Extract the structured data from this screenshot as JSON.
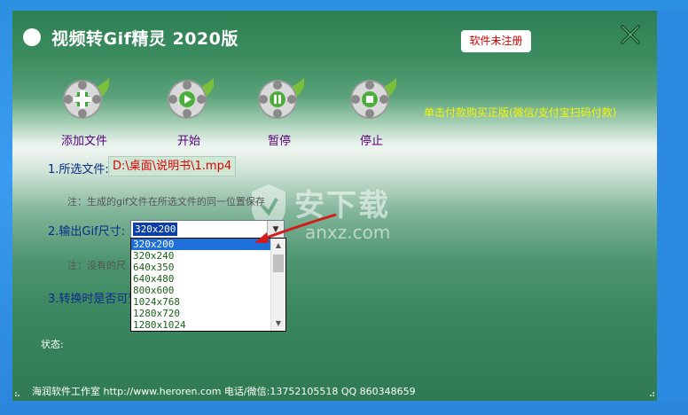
{
  "window": {
    "title": "视频转Gif精灵 2020版",
    "register_label": "软件未注册"
  },
  "toolbar": [
    {
      "label": "添加文件",
      "icon": "add-icon"
    },
    {
      "label": "开始",
      "icon": "play-icon"
    },
    {
      "label": "暂停",
      "icon": "pause-icon"
    },
    {
      "label": "停止",
      "icon": "stop-icon"
    }
  ],
  "promo_text": "单击付款购买正版(微信/支付宝扫码付款)",
  "form": {
    "file_label": "1.所选文件:",
    "file_path": "D:\\桌面\\说明书\\1.mp4",
    "file_note": "注：生成的gif文件在所选文件的同一位置保存",
    "size_label": "2.输出Gif尺寸:",
    "size_value": "320x200",
    "size_note": "注：没有的尺",
    "convert_label": "3.转换时是否可预"
  },
  "size_options": [
    "320x200",
    "320x240",
    "640x350",
    "640x480",
    "800x600",
    "1024x768",
    "1280x720",
    "1280x1024"
  ],
  "status_label": "状态:",
  "footer_text": "海润软件工作室 http://www.heroren.com  电话/微信:13752105518  QQ 860348659",
  "watermark": {
    "text": "安下载",
    "sub": "anxz.com"
  },
  "colors": {
    "accent": "#2e7f53",
    "promo": "#f5f500",
    "path_text": "#e00000",
    "selected": "#1e6fd9"
  }
}
